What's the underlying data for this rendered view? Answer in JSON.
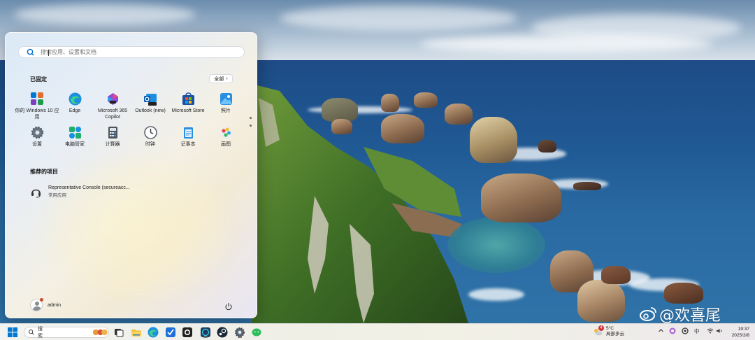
{
  "start_menu": {
    "search_placeholder": "搜索应用、设置和文档",
    "pinned_title": "已固定",
    "all_button_label": "全部",
    "pinned_apps": [
      {
        "label": "你的 Windows 10 应用",
        "icon": "windows-10-apps-icon"
      },
      {
        "label": "Edge",
        "icon": "edge-icon"
      },
      {
        "label": "Microsoft 365 Copilot",
        "icon": "m365-copilot-icon"
      },
      {
        "label": "Outlook (new)",
        "icon": "outlook-icon"
      },
      {
        "label": "Microsoft Store",
        "icon": "store-icon"
      },
      {
        "label": "照片",
        "icon": "photos-icon"
      },
      {
        "label": "设置",
        "icon": "settings-icon"
      },
      {
        "label": "电脑管家",
        "icon": "pc-manager-icon"
      },
      {
        "label": "计算器",
        "icon": "calculator-icon"
      },
      {
        "label": "时钟",
        "icon": "clock-icon"
      },
      {
        "label": "记事本",
        "icon": "notepad-icon"
      },
      {
        "label": "画图",
        "icon": "paint-icon"
      }
    ],
    "recommended_title": "推荐的项目",
    "recommended_items": [
      {
        "title": "Representative Console (secureacc...",
        "subtitle": "常用应用",
        "icon": "headset-icon"
      }
    ],
    "user_name": "admin"
  },
  "taskbar": {
    "search_label": "搜索",
    "weather": {
      "badge": "4",
      "temperature": "5°C",
      "condition": "局部多云"
    },
    "input_method": "中",
    "time": "19:37",
    "date": "2025/3/8"
  },
  "watermark": {
    "text": "@欢喜尾"
  },
  "colors": {
    "accent": "#0067c0",
    "taskbar": "#f0efe8"
  }
}
